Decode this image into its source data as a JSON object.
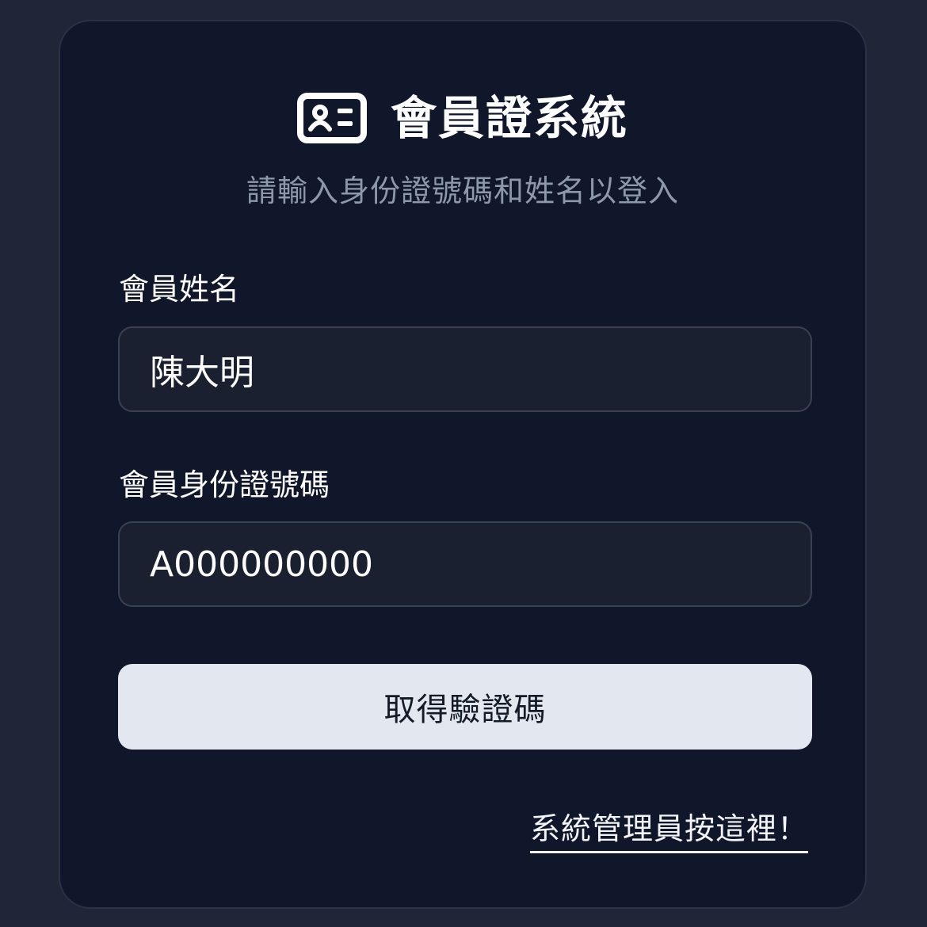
{
  "header": {
    "icon": "id-card-icon",
    "title": "會員證系統",
    "subtitle": "請輸入身份證號碼和姓名以登入"
  },
  "form": {
    "name_label": "會員姓名",
    "name_value": "陳大明",
    "id_label": "會員身份證號碼",
    "id_value": "A000000000",
    "submit_label": "取得驗證碼"
  },
  "footer": {
    "admin_link": "系統管理員按這裡！"
  },
  "colors": {
    "page_background": "#1f2638",
    "card_background": "#11172a",
    "input_background": "#1b2031",
    "button_background": "#e3e8f0",
    "subtitle_text": "#8e98ab"
  }
}
